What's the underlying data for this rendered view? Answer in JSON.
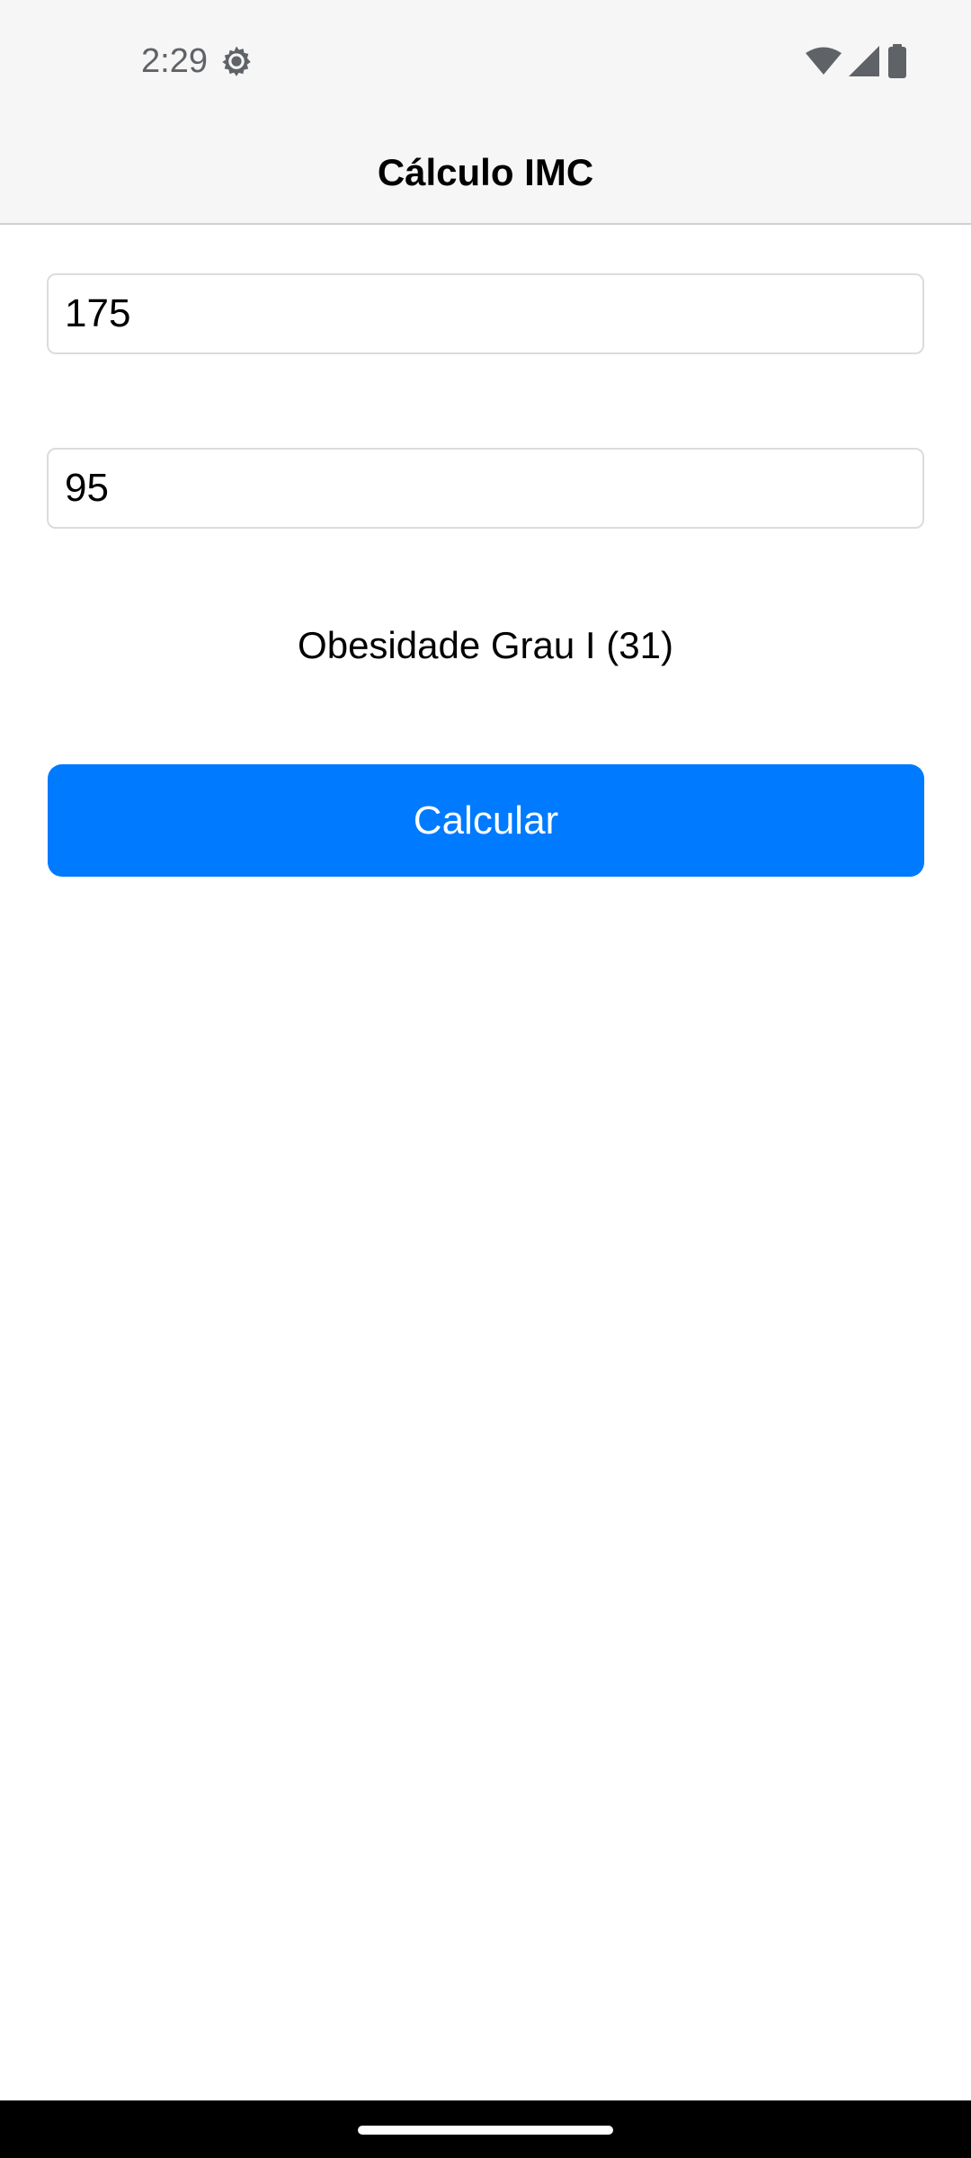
{
  "status_bar": {
    "time": "2:29",
    "icons": [
      "settings-icon",
      "wifi-icon",
      "cell-signal-icon",
      "battery-icon"
    ]
  },
  "header": {
    "title": "Cálculo IMC"
  },
  "form": {
    "height_value": "175",
    "weight_value": "95"
  },
  "result": {
    "text": "Obesidade Grau I (31)"
  },
  "actions": {
    "calculate_label": "Calcular"
  },
  "colors": {
    "accent": "#007aff",
    "header_bg": "#f6f6f6",
    "nav_bar_bg": "#000000"
  }
}
